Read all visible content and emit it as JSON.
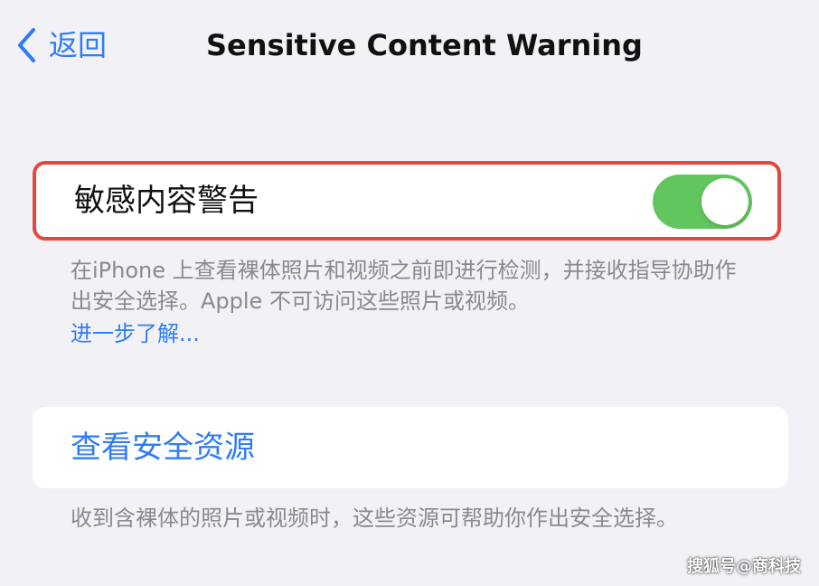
{
  "nav": {
    "back_label": "返回",
    "title": "Sensitive Content Warning"
  },
  "main_setting": {
    "label": "敏感内容警告",
    "toggle_on": true,
    "description": "在iPhone 上查看裸体照片和视频之前即进行检测，并接收指导协助作出安全选择。Apple 不可访问这些照片或视频。",
    "learn_more": "进一步了解..."
  },
  "resources": {
    "label": "查看安全资源",
    "description": "收到含裸体的照片或视频时，这些资源可帮助你作出安全选择。"
  },
  "watermark": "搜狐号@商科技",
  "colors": {
    "accent": "#2f7cf6",
    "toggle_on": "#61c65e",
    "highlight_border": "#e8453c",
    "background": "#f2f2f6"
  }
}
